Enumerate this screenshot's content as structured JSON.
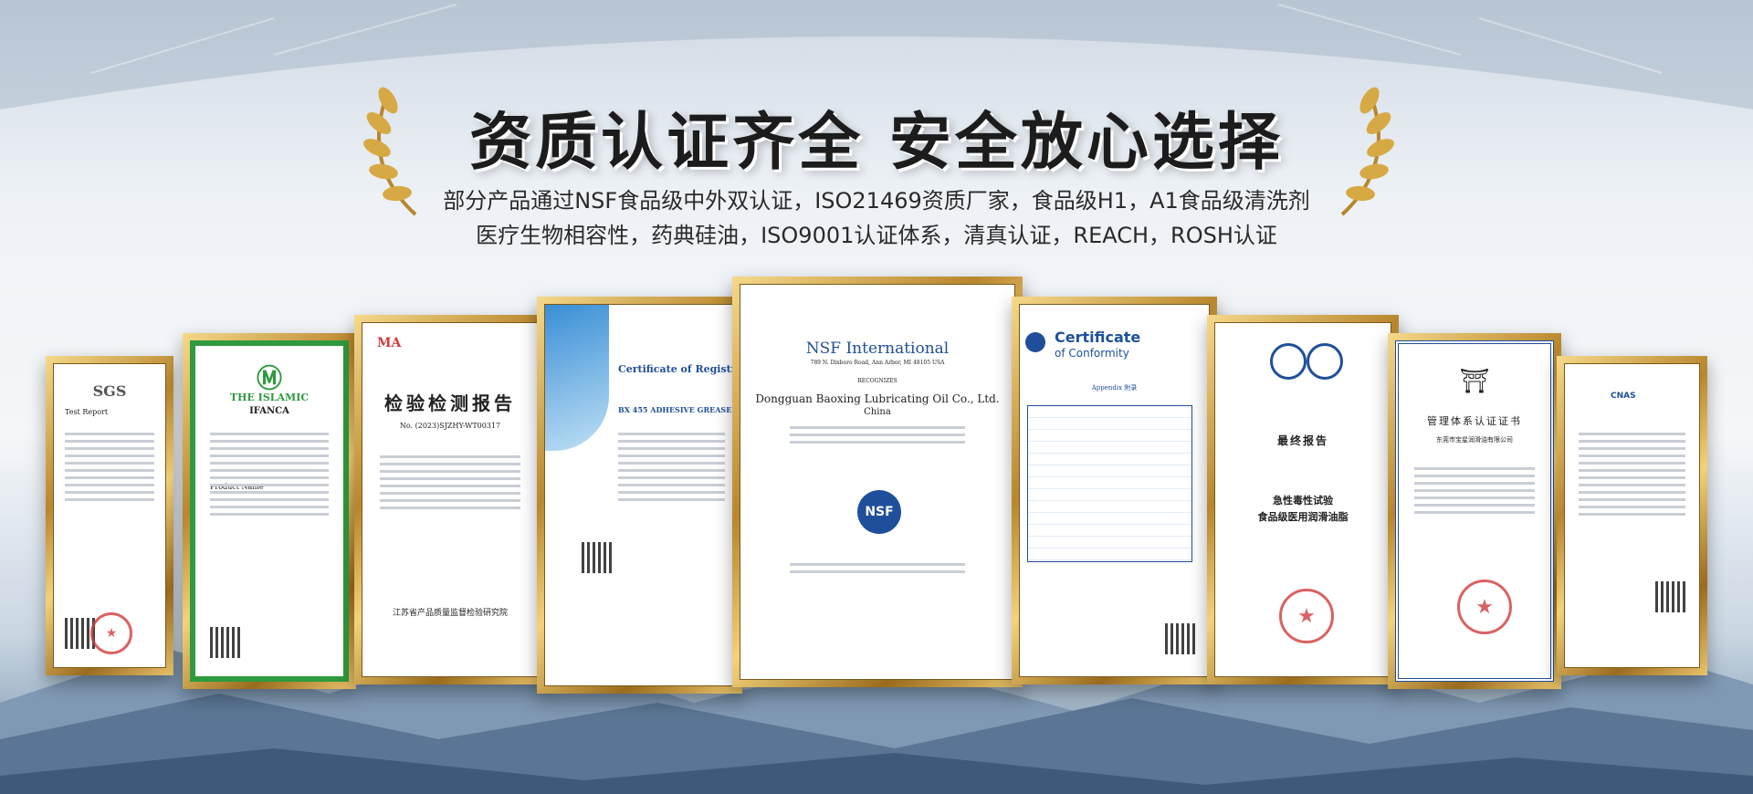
{
  "headline": "资质认证齐全 安全放心选择",
  "subtitle_line1": "部分产品通过NSF食品级中外双认证，ISO21469资质厂家，食品级H1，A1食品级清洗剂",
  "subtitle_line2": "医疗生物相容性，药典硅油，ISO9001认证体系，清真认证，REACH，ROSH认证",
  "certificates": {
    "sgs": {
      "logo": "SGS",
      "label": "Test Report"
    },
    "halal": {
      "logo": "IFANCA",
      "heading": "THE ISLAMIC",
      "line": "Product Name"
    },
    "inspection": {
      "logo": "MA",
      "title": "检验检测报告",
      "number": "No. (2023)SJZHY-WT00317",
      "footer": "江苏省产品质量监督检验研究院"
    },
    "nsf_reg": {
      "title": "Certificate of Registration",
      "product": "BX 455 ADHESIVE GREASE"
    },
    "nsf_intl": {
      "org": "NSF International",
      "address": "789 N. Dixboro Road, Ann Arbor, MI 48105 USA",
      "recognizes": "RECOGNIZES",
      "company": "Dongguan Baoxing Lubricating Oil Co., Ltd.",
      "country": "China",
      "logo": "NSF"
    },
    "conformity": {
      "title": "Certificate",
      "subtitle": "of Conformity",
      "appendix": "Appendix 附录"
    },
    "final_report": {
      "title": "最终报告",
      "test": "急性毒性试验",
      "product": "食品级医用润滑油脂"
    },
    "mgmt": {
      "title": "管理体系认证证书",
      "company": "东莞市宝星润滑油有限公司"
    },
    "lab": {
      "logo": "CNAS"
    }
  },
  "colors": {
    "gold": "#c8962e",
    "nsf_blue": "#1f4f9a",
    "stamp_red": "#d23b3b"
  }
}
